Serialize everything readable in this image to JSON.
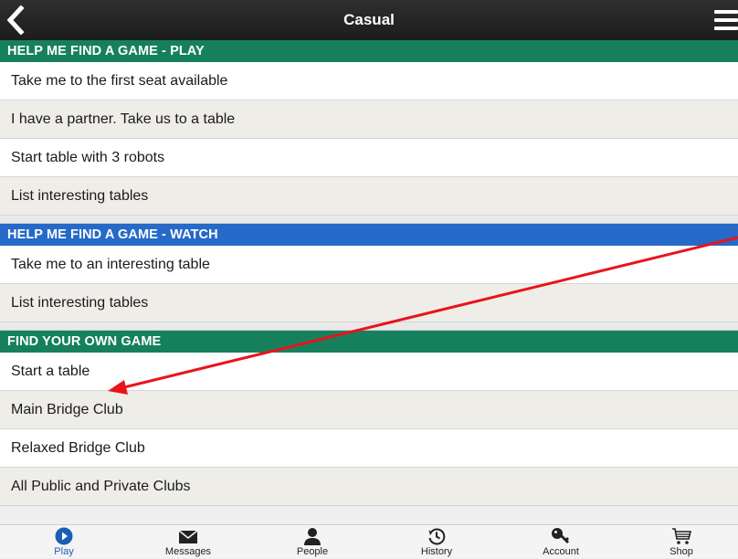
{
  "header": {
    "title": "Casual"
  },
  "sections": [
    {
      "title": "HELP ME FIND A GAME - PLAY",
      "color": "#16805d",
      "items": [
        "Take me to the first seat available",
        "I have a partner. Take us to a table",
        "Start table with 3 robots",
        "List interesting tables"
      ]
    },
    {
      "title": "HELP ME FIND A GAME - WATCH",
      "color": "#2669c8",
      "items": [
        "Take me to an interesting table",
        "List interesting tables"
      ]
    },
    {
      "title": "FIND YOUR OWN GAME",
      "color": "#16805d",
      "items": [
        "Start a table",
        "Main Bridge Club",
        "Relaxed Bridge Club",
        "All Public and Private Clubs"
      ]
    }
  ],
  "tabs": [
    {
      "label": "Play",
      "icon": "play-icon",
      "active": true
    },
    {
      "label": "Messages",
      "icon": "envelope-icon"
    },
    {
      "label": "People",
      "icon": "person-icon"
    },
    {
      "label": "History",
      "icon": "history-icon"
    },
    {
      "label": "Account",
      "icon": "key-icon"
    },
    {
      "label": "Shop",
      "icon": "cart-icon"
    }
  ],
  "colors": {
    "annotation_arrow": "#e8141b",
    "active_tab": "#1a5fb4"
  }
}
